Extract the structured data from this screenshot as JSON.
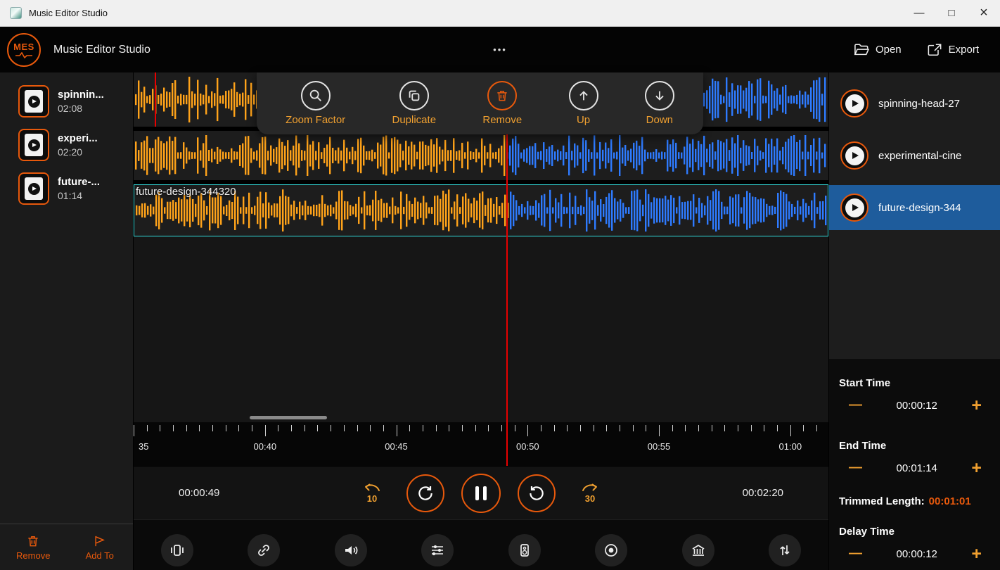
{
  "titlebar": {
    "title": "Music Editor Studio",
    "minimize": "—",
    "maximize": "□",
    "close": "×"
  },
  "appbar": {
    "logo_text": "MES",
    "title": "Music Editor Studio",
    "menu_dots": "•••",
    "open_label": "Open",
    "export_label": "Export"
  },
  "library": {
    "items": [
      {
        "name": "spinnin...",
        "duration": "02:08"
      },
      {
        "name": "experi...",
        "duration": "02:20"
      },
      {
        "name": "future-...",
        "duration": "01:14"
      }
    ],
    "remove_label": "Remove",
    "add_to_label": "Add To"
  },
  "float_toolbar": {
    "zoom": "Zoom Factor",
    "duplicate": "Duplicate",
    "remove": "Remove",
    "up": "Up",
    "down": "Down"
  },
  "editor": {
    "selected_track_label": "future-design-344320"
  },
  "timeline": {
    "labels": [
      "35",
      "00:40",
      "00:45",
      "00:50",
      "00:55",
      "01:00"
    ]
  },
  "transport": {
    "current_time": "00:00:49",
    "total_time": "00:02:20",
    "skip_back": "10",
    "skip_forward": "30"
  },
  "playlist": {
    "items": [
      {
        "name": "spinning-head-27",
        "selected": false
      },
      {
        "name": "experimental-cine",
        "selected": false
      },
      {
        "name": "future-design-344",
        "selected": true
      }
    ]
  },
  "properties": {
    "start_label": "Start Time",
    "start_value": "00:00:12",
    "end_label": "End Time",
    "end_value": "00:01:14",
    "trimmed_label": "Trimmed Length:",
    "trimmed_value": "00:01:01",
    "delay_label": "Delay Time",
    "delay_value": "00:00:12",
    "minus": "—",
    "plus": "+"
  },
  "colors": {
    "accent": "#e8590c",
    "amber": "#f0a030",
    "wave_played": "#ffa31a",
    "wave_unplayed": "#2e7bff",
    "selection_border": "#33dddd",
    "playhead": "#e80000",
    "selected_row": "#1e5c9c"
  }
}
